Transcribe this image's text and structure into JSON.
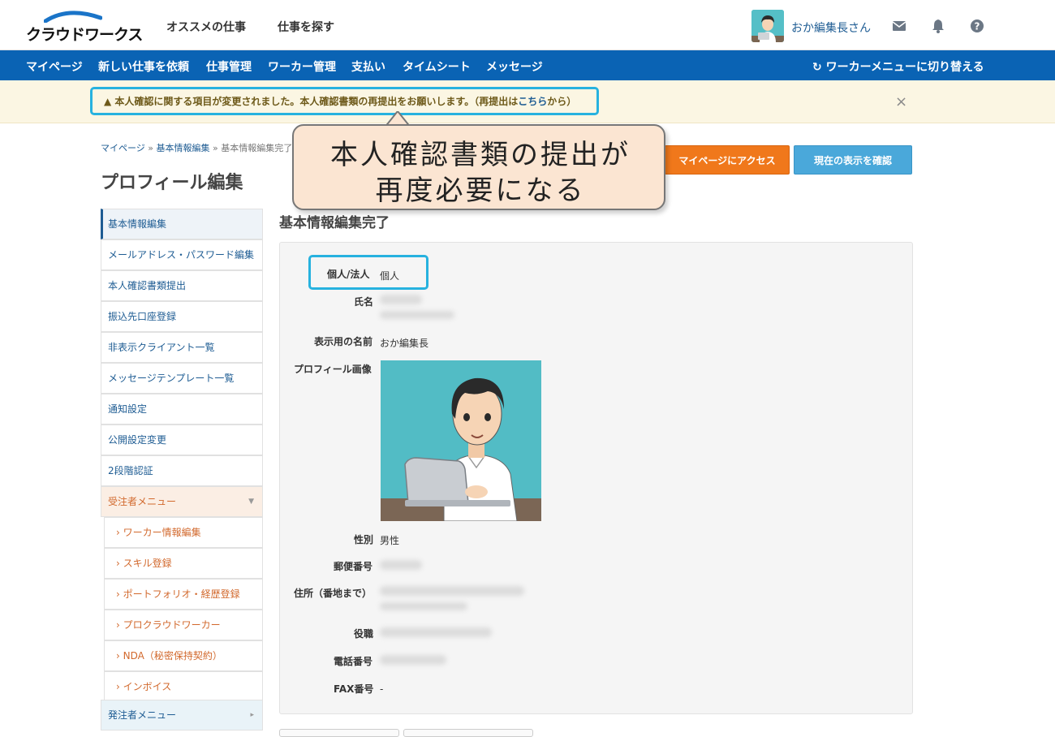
{
  "header": {
    "logo_text": "クラウドワークス",
    "links": [
      "オススメの仕事",
      "仕事を探す"
    ],
    "username": "おか編集長さん",
    "icons": [
      "mail-icon",
      "bell-icon",
      "help-icon"
    ]
  },
  "nav": {
    "items": [
      "マイページ",
      "新しい仕事を依頼",
      "仕事管理",
      "ワーカー管理",
      "支払い",
      "タイムシート",
      "メッセージ"
    ],
    "switch_label": "ワーカーメニューに切り替える"
  },
  "alert": {
    "text": "本人確認に関する項目が変更されました。本人確認書類の再提出をお願いします。（再提出は",
    "link": "こちら",
    "suffix": "から）",
    "close": "×"
  },
  "callout": {
    "line1": "本人確認書類の提出が",
    "line2": "再度必要になる"
  },
  "breadcrumb": {
    "items": [
      "マイページ",
      "基本情報編集",
      "基本情報編集完了"
    ],
    "separator": "»"
  },
  "page_title": "プロフィール編集",
  "buttons": {
    "mypage": "マイページにアクセス",
    "preview": "現在の表示を確認"
  },
  "sidebar": {
    "items": [
      "基本情報編集",
      "メールアドレス・パスワード編集",
      "本人確認書類提出",
      "振込先口座登録",
      "非表示クライアント一覧",
      "メッセージテンプレート一覧",
      "通知設定",
      "公開設定変更",
      "2段階認証"
    ],
    "worker_section": "受注者メニュー",
    "worker_items": [
      "ワーカー情報編集",
      "スキル登録",
      "ポートフォリオ・経歴登録",
      "プロクラウドワーカー",
      "NDA（秘密保持契約）",
      "インボイス"
    ],
    "client_section": "発注者メニュー"
  },
  "section_title": "基本情報編集完了",
  "fields": {
    "type_label": "個人/法人",
    "type_value": "個人",
    "name_label": "氏名",
    "display_label": "表示用の名前",
    "display_value": "おか編集長",
    "image_label": "プロフィール画像",
    "gender_label": "性別",
    "gender_value": "男性",
    "zip_label": "郵便番号",
    "address_label": "住所（番地まで）",
    "title_label": "役職",
    "phone_label": "電話番号",
    "fax_label": "FAX番号",
    "fax_value": "-"
  },
  "colors": {
    "nav_blue": "#0a63b4",
    "accent_orange": "#f0781b",
    "highlight_cyan": "#27b2df",
    "worker_orange": "#d2692d"
  }
}
